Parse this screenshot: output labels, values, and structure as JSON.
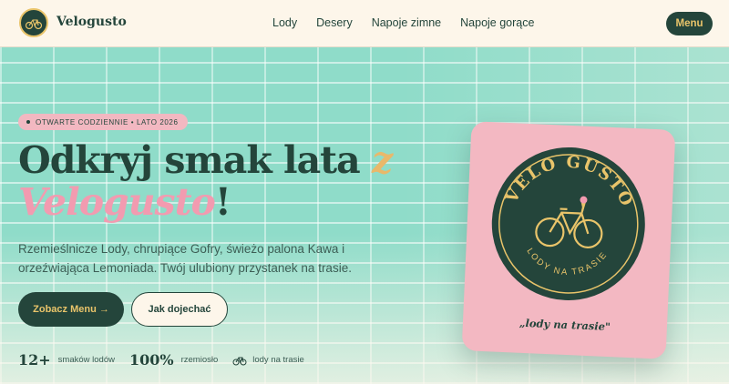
{
  "header": {
    "brand": "Velogusto",
    "nav": [
      "Lody",
      "Desery",
      "Napoje zimne",
      "Napoje gorące"
    ],
    "menu_label": "Menu"
  },
  "hero": {
    "pill": "OTWARTE CODZIENNIE • LATO 2026",
    "headline_part1": "Odkryj smak lata ",
    "headline_z": "z",
    "headline_brand": "Velogusto",
    "headline_end": "!",
    "lead": "Rzemieślnicze Lody, chrupiące Gofry, świeżo palona Kawa i orzeźwiająca Lemoniada. Twój ulubiony przystanek na trasie.",
    "primary_btn": "Zobacz Menu →",
    "secondary_btn": "Jak dojechać",
    "stats": [
      {
        "num": "12+",
        "label": "smaków lodów"
      },
      {
        "num": "100%",
        "label": "rzemiosło"
      },
      {
        "label": "lody na trasie"
      }
    ]
  },
  "card": {
    "seal_top": "VELO GUSTO",
    "seal_bottom": "LODY NA TRASIE",
    "caption": "„lody na trasie\""
  },
  "colors": {
    "primary": "#24453b",
    "accent_gold": "#e9c46a",
    "accent_pink": "#f29bb0",
    "mint": "#8fdcc9",
    "cream": "#fdf6ea"
  }
}
